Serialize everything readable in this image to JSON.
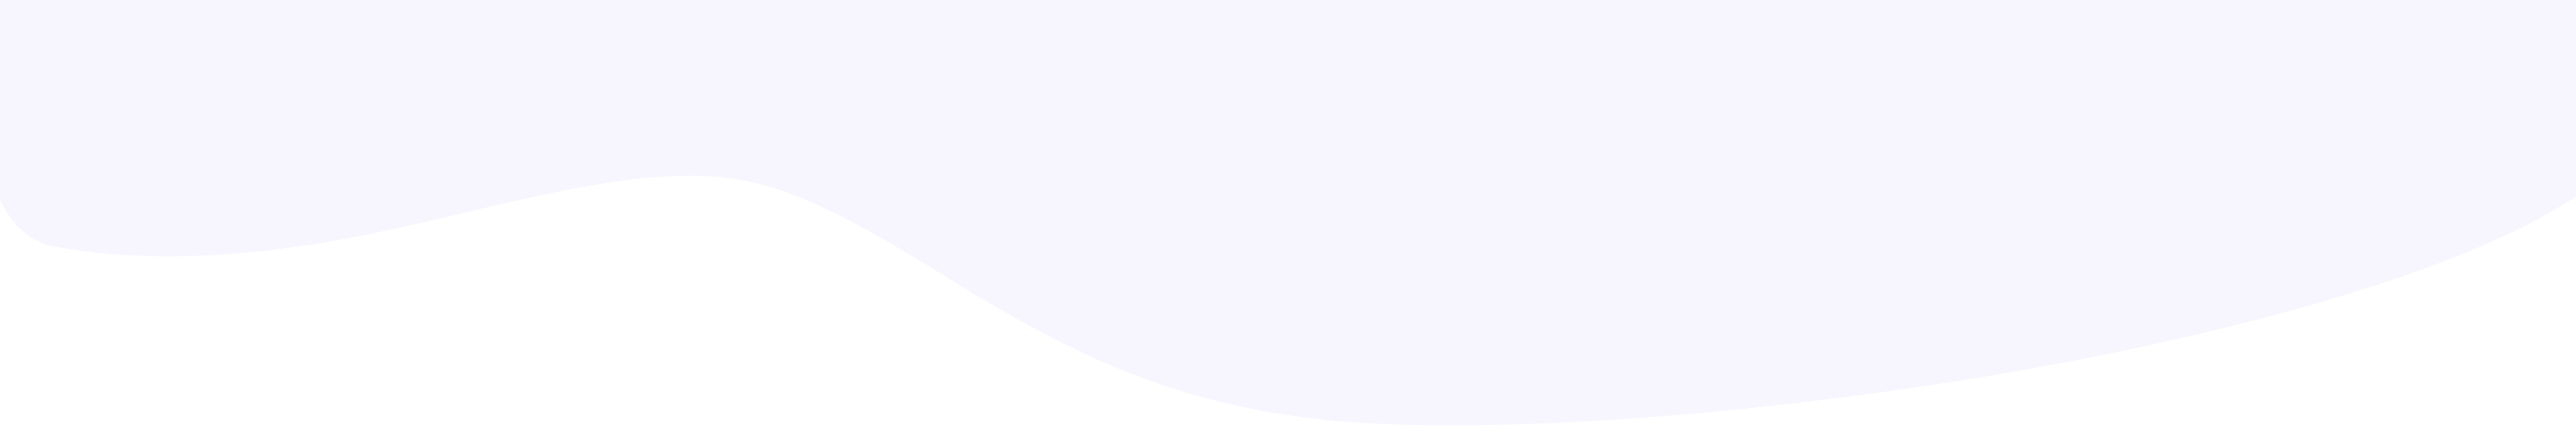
{
  "background": {
    "page_color": "#ffffff",
    "wave_color": "#f7f5fe"
  }
}
